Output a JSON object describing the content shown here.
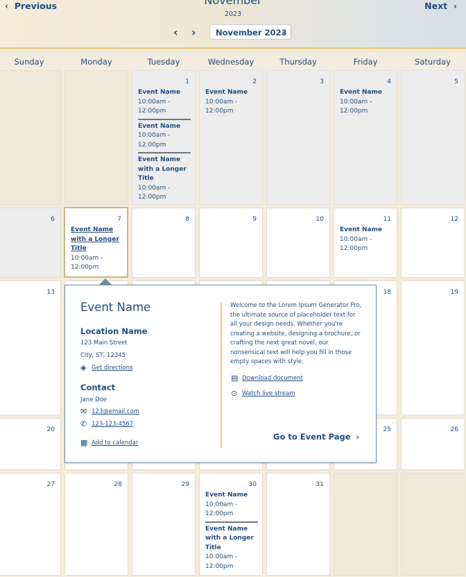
{
  "header": {
    "previous_label": "Previous",
    "next_label": "Next",
    "month_title": "November",
    "year": "2023",
    "picker_value": "November 2023"
  },
  "weekdays": [
    "Sunday",
    "Monday",
    "Tuesday",
    "Wednesday",
    "Thursday",
    "Friday",
    "Saturday"
  ],
  "days": {
    "d1": "1",
    "d2": "2",
    "d3": "3",
    "d4": "4",
    "d5": "5",
    "d6": "6",
    "d7": "7",
    "d8": "8",
    "d9": "9",
    "d10": "10",
    "d11": "11",
    "d12": "12",
    "d13": "13",
    "d18": "18",
    "d19": "19",
    "d20": "20",
    "d25": "25",
    "d26": "26",
    "d27": "27",
    "d28": "28",
    "d29": "29",
    "d30": "30",
    "d31": "31"
  },
  "events": {
    "name": "Event Name",
    "long_name": "Event Name with a Longer Title",
    "time": "10:00am - 12:00pm"
  },
  "popup": {
    "title": "Event Name",
    "location_heading": "Location Name",
    "street": "123 Main Street",
    "city": "City, ST, 12345",
    "directions": "Get directions",
    "contact_heading": "Contact",
    "contact_name": "Jane Doe",
    "email": "123@email.com",
    "phone": "123-123-4567",
    "add_calendar": "Add to calendar",
    "description": "Welcome to the Lorem Ipsum Generator Pro, the ultimate source of placeholder text for all your design needs. Whether you're creating a website, designing a brochure, or crafting the next great novel, our nonsensical text will help you fill in those empty spaces with style.",
    "download": "Download document",
    "stream": "Watch live stream",
    "go_to": "Go to Event Page"
  },
  "icons": {
    "prev": "chevron-left-icon",
    "next": "chevron-right-icon",
    "directions": "directions-icon",
    "email": "mail-icon",
    "phone": "phone-icon",
    "calendar": "calendar-icon",
    "download": "document-icon",
    "stream": "play-icon"
  },
  "colors": {
    "brand": "#1f4d80",
    "accent": "#ecd38a",
    "divider": "#e6c97a"
  }
}
